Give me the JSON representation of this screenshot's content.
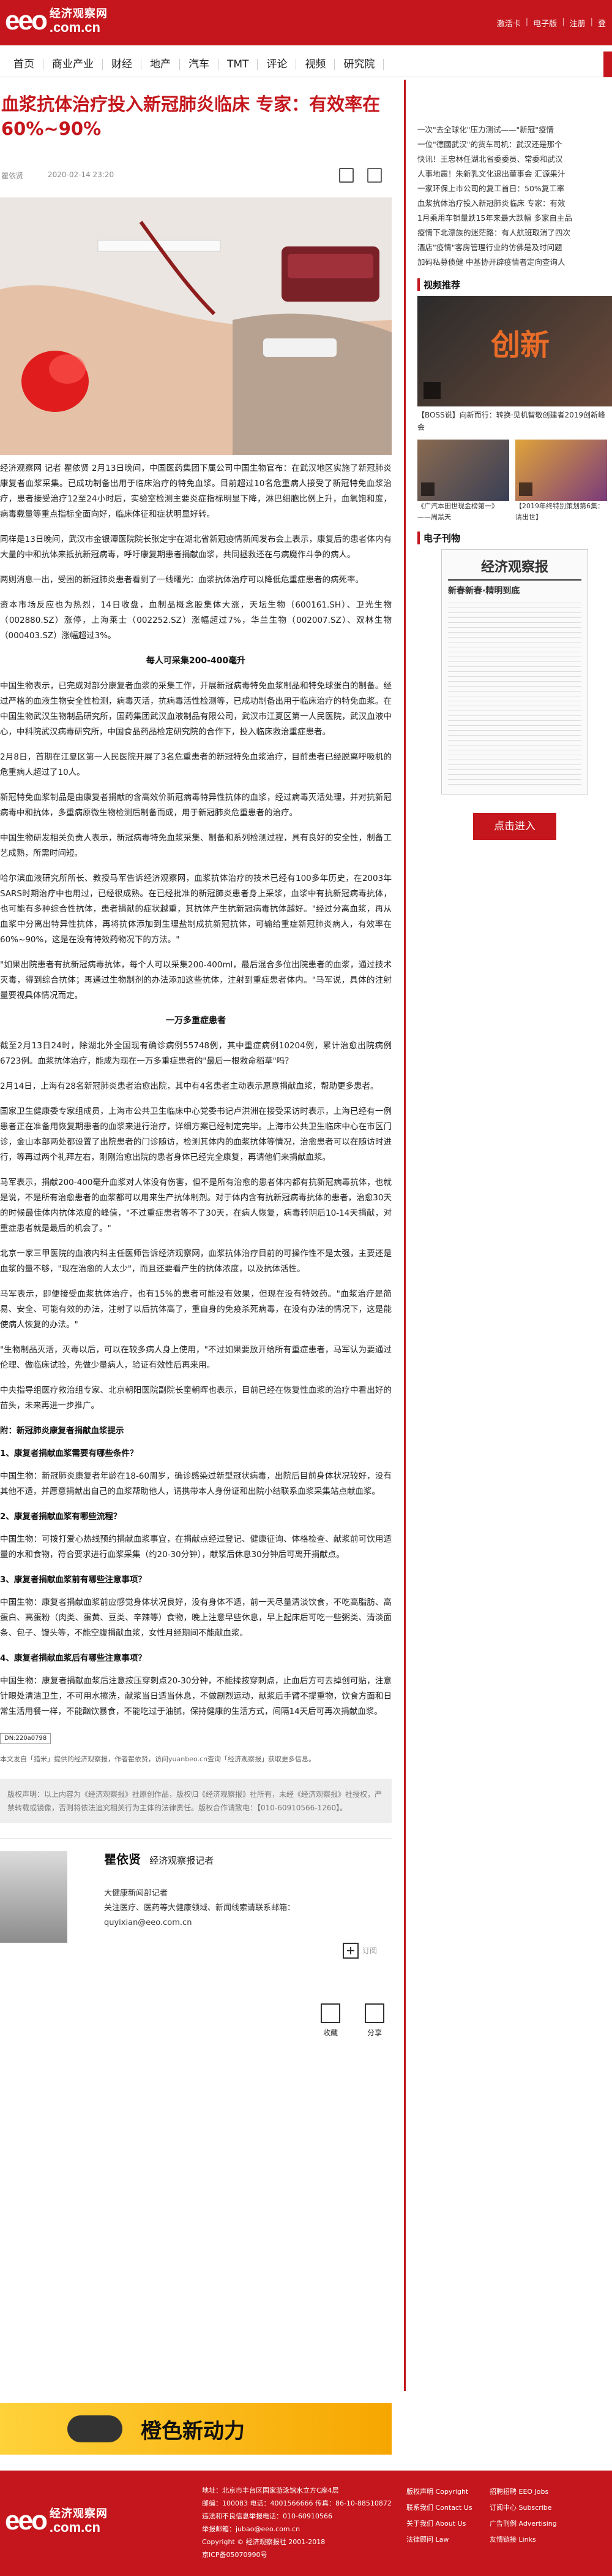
{
  "header": {
    "logo_text": "eeo",
    "logo_cn": "经济观察网",
    "logo_domain": ".com.cn",
    "links": [
      "激活卡",
      "电子版",
      "注册",
      "登"
    ]
  },
  "nav": [
    "首页",
    "商业产业",
    "财经",
    "地产",
    "汽车",
    "TMT",
    "评论",
    "视频",
    "研究院"
  ],
  "article": {
    "title": "血浆抗体治疗投入新冠肺炎临床 专家：有效率在60%~90%",
    "author": "瞿依贤",
    "time": "2020-02-14 23:20",
    "paragraphs": [
      "经济观察网  记者  瞿依贤    2月13日晚间，中国医药集团下属公司中国生物官布：在武汉地区实施了新冠肺炎康复者血浆采集。已成功制备出用于临床治疗的特免血浆。目前超过10名危重病人接受了新冠特免血浆治疗，患者接受治疗12至24小时后，实验室检测主要炎症指标明显下降，淋巴细胞比例上升，血氧饱和度，病毒载量等重点指标全面向好，临床体征和症状明显好转。",
      "同样是13日晚间，武汉市金银潭医院院长张定宇在湖北省新冠疫情新闻发布会上表示，康复后的患者体内有大量的中和抗体来抵抗新冠病毒，呼吁康复期患者捐献血浆，共同拯救还在与病魔作斗争的病人。",
      "两则消息一出，受困的新冠肺炎患者看到了一线曙光：血浆抗体治疗可以降低危重症患者的病死率。",
      "资本市场反应也为热烈，14日收盘，血制品概念股集体大涨，天坛生物（600161.SH）、卫光生物（002880.SZ）涨停，上海莱士（002252.SZ）涨幅超过7%，华兰生物（002007.SZ）、双林生物（000403.SZ）涨幅超过3%。"
    ],
    "section1_title": "每人可采集200-400毫升",
    "paragraphs2": [
      "中国生物表示，已完成对部分康复者血浆的采集工作，开展新冠病毒特免血浆制品和特免球蛋白的制备。经过严格的血液生物安全性检测，病毒灭活，抗病毒活性检测等，已成功制备出用于临床治疗的特免血浆。在中国生物武汉生物制品研究所，国药集团武汉血液制品有限公司，武汉市江夏区第一人民医院，武汉血液中心，中科院武汉病毒研究所，中国食品药品检定研究院的合作下，投入临床救治重症患者。",
      "2月8日，首期在江夏区第一人民医院开展了3名危重患者的新冠特免血浆治疗，目前患者已经脱离呼吸机的危重病人超过了10人。",
      "新冠特免血浆制品是由康复者捐献的含高效价新冠病毒特异性抗体的血浆，经过病毒灭活处理，并对抗新冠病毒中和抗体，多重病原微生物检测后制备而成，用于新冠肺炎危重患者的治疗。",
      "中国生物研发相关负责人表示，新冠病毒特免血浆采集、制备和系列检测过程，具有良好的安全性，制备工艺成熟，所需时间短。",
      "哈尔滨血液研究所所长、教授马军告诉经济观察网，血浆抗体治疗的技术已经有100多年历史，在2003年SARS时期治疗中也用过，已经很成熟。在已经批准的新冠肺炎患者身上采浆，血浆中有抗新冠病毒抗体，也可能有多种综合性抗体，患者捐献的症状越重，其抗体产生抗新冠病毒抗体越好。\"经过分离血浆，再从血浆中分离出特异性抗体，再将抗体添加到生理盐制成抗新冠抗体，可输给重症新冠肺炎病人，有效率在60%~90%，这是在没有特效药物况下的方法。\"",
      "\"如果出院患者有抗新冠病毒抗体，每个人可以采集200-400ml，最后混合多位出院患者的血浆，通过技术灭毒，得到综合抗体；再通过生物制剂的办法添加这些抗体，注射到重症患者体内。\"马军说，具体的注射量要视具体情况而定。"
    ],
    "section2_title": "一万多重症患者",
    "paragraphs3": [
      "截至2月13日24时，除湖北外全国现有确诊病例55748例，其中重症病例10204例，累计治愈出院病例6723例。血浆抗体治疗，能成为现在一万多重症患者的\"最后一根救命稻草\"吗？",
      "2月14日，上海有28名新冠肺炎患者治愈出院，其中有4名患者主动表示愿意捐献血浆，帮助更多患者。",
      "国家卫生健康委专家组成员，上海市公共卫生临床中心党委书记卢洪洲在接受采访时表示，上海已经有一例患者正在准备用恢复期患者的血浆来进行治疗，详细方案已经制定完毕。上海市公共卫生临床中心在市区门诊，金山本部两处都设置了出院患者的门诊随访，检测其体内的血浆抗体等情况，治愈患者可以在随访时进行，等再过两个礼拜左右，刚刚治愈出院的患者身体已经完全康复，再请他们来捐献血浆。",
      "马军表示，捐献200-400毫升血浆对人体没有伤害，但不是所有治愈的患者体内都有抗新冠病毒抗体，也就是说，不是所有治愈患者的血浆都可以用来生产抗体制剂。对于体内含有抗新冠病毒抗体的患者，治愈30天的时候最佳体内抗体浓度的峰值，\"不过重症患者等不了30天，在病人恢复，病毒转阴后10-14天捐献，对重症患者就是最后的机会了。\"",
      "北京一家三甲医院的血液内科主任医师告诉经济观察网，血浆抗体治疗目前的可操作性不是太强，主要还是血浆的量不够，\"现在治愈的人太少\"，而且还要看产生的抗体浓度，以及抗体活性。",
      "马军表示，即便接受血浆抗体治疗，也有15%的患者可能没有效果，但现在没有特效药。\"血浆治疗是简易、安全、可能有效的办法，注射了以后抗体高了，重自身的免疫杀死病毒，在没有办法的情况下，这是能使病人恢复的办法。\"",
      "\"生物制品灭活，灭毒以后，可以在较多病人身上使用，\"不过如果要放开给所有重症患者，马军认为要通过伦理、做临床试验，先做少量病人，验证有效性后再来用。",
      "中央指导组医疗救治组专家、北京朝阳医院副院长童朝晖也表示，目前已经在恢复性血浆的治疗中看出好的苗头，未来再进一步推广。"
    ],
    "appendix_title": "附：新冠肺炎康复者捐献血浆提示",
    "qa": [
      {
        "q": "1、康复者捐献血浆需要有哪些条件？",
        "a": "中国生物：新冠肺炎康复者年龄在18-60周岁，确诊感染过新型冠状病毒，出院后目前身体状况较好，没有其他不适，并愿意捐献出自己的血浆帮助他人，请携带本人身份证和出院小结联系血浆采集站点献血浆。"
      },
      {
        "q": "2、康复者捐献血浆有哪些流程？",
        "a": "中国生物：可拨打爱心热线预约捐献血浆事宜，在捐献点经过登记、健康征询、体格检查、献浆前可饮用适量的水和食物，符合要求进行血浆采集（约20-30分钟），献浆后休息30分钟后可离开捐献点。"
      },
      {
        "q": "3、康复者捐献血浆前有哪些注意事项？",
        "a": "中国生物：康复者捐献血浆前应感觉身体状况良好，没有身体不适，前一天尽量清淡饮食，不吃高脂肪、高蛋白、高蛋粉（肉类、蛋黄、豆类、辛辣等）食物，晚上注意早些休息，早上起床后可吃一些粥类、清淡面条、包子、馒头等，不能空腹捐献血浆，女性月经期间不能献血浆。"
      },
      {
        "q": "4、康复者捐献血浆后有哪些注意事项？",
        "a": "中国生物：康复者捐献血浆后注意按压穿刺点20-30分钟，不能揉按穿刺点，止血后方可去掉创可贴，注意针眼处清洁卫生，不可用水擦洗，献浆当日适当休息，不做剧烈运动，献浆后手臂不提重物，饮食方面和日常生活用餐一样，不能酗饮暴食，不能吃过于油腻，保持健康的生活方式，间隔14天后可再次捐献血浆。"
      }
    ],
    "tag": "DN:220a0798",
    "source_note": "本文发自「猎米」提供的经济观察报，作者瞿依贤，访问yuanbeo.cn查询「经济观察报」获取更多信息。",
    "copyright": "版权声明：以上内容为《经济观察报》社原创作品，版权归《经济观察报》社所有，未经《经济观察报》社授权，严禁转载或镜像，否则将依法追究相关行为主体的法律责任。版权合作请致电：【010-60910566-1260】。"
  },
  "author_card": {
    "name": "瞿依贤",
    "role": "经济观察报记者",
    "desc1": "大健康新闻部记者",
    "desc2": "关注医疗、医药等大健康领域、新闻线索请联系邮箱：",
    "email": "quyixian@eeo.com.cn",
    "follow": "订阅"
  },
  "actions": {
    "fav": "收藏",
    "share": "分享"
  },
  "sidebar": {
    "news": [
      "一次\"去全球化\"压力测试——\"新冠\"疫情",
      "一位\"德國武汉\"的货车司机：武汉还是那个",
      "快讯！王忠林任湖北省委委员、常委和武汉",
      "人事地震！朱新乳文化退出董事会 汇源果汁",
      "一家环保上市公司的复工首日：50%复工率",
      "血浆抗体治疗投入新冠肺炎临床 专家：有效",
      "1月乘用车销量跌15年来最大跌幅 多家自主品",
      "疫情下北漂族的迷茫路：有人航班取消了四次",
      "酒店\"疫情\"客房管理行业的仿佛是及时问题",
      "加码私募债健 中基协开辟疫情者定向查询人"
    ],
    "video_section": "视频推荐",
    "video1_caption": "【BOSS说】向新而行：转换·见机智敬创建者2019创新峰会",
    "video2_caption": "《广汽本田世现金榜第一》——周黑天",
    "video3_caption": "【2019年终特别策划第6集：请出世】",
    "epaper_section": "电子刊物",
    "epaper_title": "经济观察报",
    "epaper_headline": "新春新春·精明到底",
    "enter_button": "点击进入"
  },
  "banner": {
    "text": "橙色新动力"
  },
  "footer": {
    "address": "地址：北京市丰台区国家游泳馆水立方C座4层",
    "phone": "邮编：100083  电话：4001566666  传真：86-10-88510872",
    "license": "违法和不良信息举报电话：010-60910566",
    "email": "举报邮箱：jubao@eeo.com.cn",
    "copyright": "Copyright © 经济观察报社 2001-2018",
    "icp": "京ICP备05070990号",
    "links_col1": [
      "版权声明 Copyright",
      "联系我们 Contact Us",
      "关于我们 About Us",
      "法律顾问 Law"
    ],
    "links_col2": [
      "招聘招聘 EEO Jobs",
      "订阅中心 Subscribe",
      "广告刊例 Advertising",
      "友情链接 Links"
    ]
  }
}
